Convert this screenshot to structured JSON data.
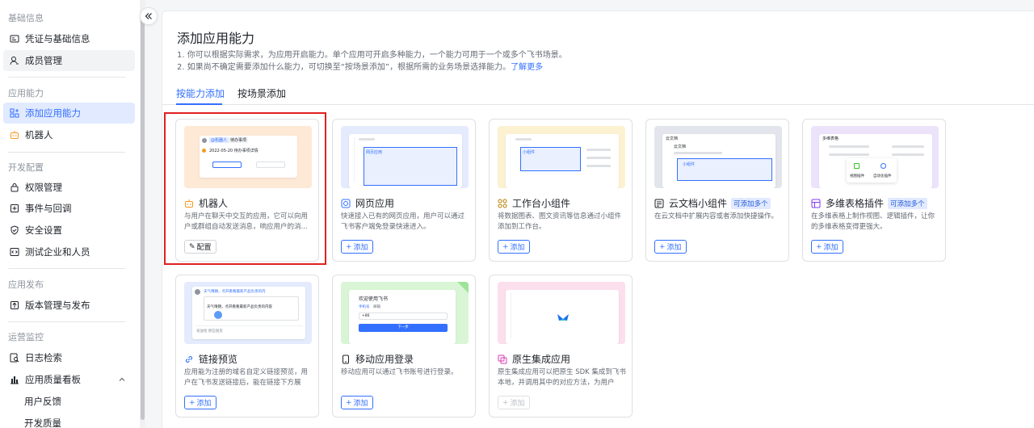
{
  "sidebar": {
    "sections": [
      {
        "label": "基础信息"
      },
      {
        "label": "应用能力"
      },
      {
        "label": "开发配置"
      },
      {
        "label": "应用发布"
      },
      {
        "label": "运营监控"
      }
    ],
    "items": {
      "credentials": "凭证与基础信息",
      "members": "成员管理",
      "add_capability": "添加应用能力",
      "bot": "机器人",
      "permissions": "权限管理",
      "events": "事件与回调",
      "security": "安全设置",
      "test_company": "测试企业和人员",
      "version": "版本管理与发布",
      "logs": "日志检索",
      "quality_board": "应用质量看板",
      "user_feedback": "用户反馈",
      "dev_quality": "开发质量"
    }
  },
  "main": {
    "title": "添加应用能力",
    "desc1": "1. 你可以根据实际需求，为应用开启能力。单个应用可开启多种能力，一个能力可用于一个或多个飞书场景。",
    "desc2": "2. 如果尚不确定需要添加什么能力，可切换至“按场景添加”，根据所需的业务场景选择能力。",
    "learn_more": "了解更多",
    "tabs": [
      "按能力添加",
      "按场景添加"
    ]
  },
  "cards": [
    {
      "title": "机器人",
      "desc": "与用户在聊天中交互的应用，它可以向用户或群组自动发送消息，响应用户的消...",
      "button": "配置",
      "icon": "robot-icon"
    },
    {
      "title": "网页应用",
      "desc": "快速接入已有的网页应用，用户可以通过飞书客户端免登录快速进入。",
      "button": "添加",
      "icon": "web-icon"
    },
    {
      "title": "工作台小组件",
      "desc": "将数据图表、图文资讯等信息通过小组件添加到工作台。",
      "button": "添加",
      "icon": "widget-icon"
    },
    {
      "title": "云文档小组件",
      "badge": "可添加多个",
      "desc": "在云文档中扩展内容或者添加快捷操作。",
      "button": "添加",
      "icon": "doc-icon"
    },
    {
      "title": "多维表格插件",
      "badge": "可添加多个",
      "desc": "在多维表格上制作视图、逻辑插件，让你的多维表格变得更强大。",
      "button": "添加",
      "icon": "bitable-icon"
    },
    {
      "title": "链接预览",
      "desc": "应用能为注册的域名自定义链接预览，用户在飞书发送链接后，能在链接下方展示...",
      "button": "添加",
      "icon": "link-icon"
    },
    {
      "title": "移动应用登录",
      "desc": "移动应用可以通过飞书账号进行登录。",
      "button": "添加",
      "icon": "mobile-icon"
    },
    {
      "title": "原生集成应用",
      "desc": "原生集成应用可以把原生 SDK 集成到飞书本地，并调用其中的对应方法，为用户提...",
      "button": "添加",
      "icon": "native-icon"
    }
  ],
  "previews": {
    "bot_tag1": "@机器人",
    "bot_tag2": "待办事项",
    "bot_text": "2022-05-20 待办事项详情",
    "web_label": "网页应用",
    "widget_label": "小组件",
    "doc_title": "云文档",
    "doc_sub": "云文档",
    "doc_widget": "小组件",
    "bitable_title": "多维表格",
    "bitable_view": "视图插件",
    "bitable_auto": "自动化插件",
    "link_msg": "天气晴朗，点开看看最新产品负责的内",
    "link_msg2": "天气晴朗，点开看看最新产品负责的内容",
    "link_input": "发送给 那些朋友",
    "mobile_title": "欢迎使用飞书",
    "mobile_tab1": "手机号",
    "mobile_tab2": "邮箱",
    "mobile_code": "+86",
    "mobile_btn": "下一步"
  }
}
